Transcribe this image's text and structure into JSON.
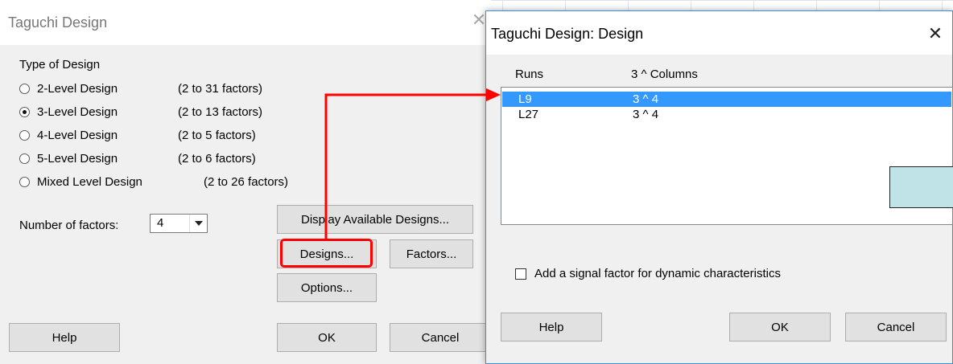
{
  "dialog1": {
    "title": "Taguchi Design",
    "close_glyph": "✕",
    "type_group_label": "Type of Design",
    "designs": [
      {
        "label": "2-Level Design",
        "range": "(2 to 31 factors)",
        "checked": false
      },
      {
        "label": "3-Level Design",
        "range": "(2 to 13 factors)",
        "checked": true
      },
      {
        "label": "4-Level Design",
        "range": "(2 to 5 factors)",
        "checked": false
      },
      {
        "label": "5-Level Design",
        "range": "(2 to 6 factors)",
        "checked": false
      },
      {
        "label": "Mixed Level Design",
        "range": "(2 to 26 factors)",
        "checked": false
      }
    ],
    "num_factors_label": "Number of factors:",
    "num_factors_value": "4",
    "buttons": {
      "display_available": "Display Available Designs...",
      "designs": "Designs...",
      "factors": "Factors...",
      "options": "Options...",
      "help": "Help",
      "ok": "OK",
      "cancel": "Cancel"
    }
  },
  "dialog2": {
    "title": "Taguchi Design: Design",
    "close_glyph": "✕",
    "col_runs": "Runs",
    "col_columns": "3 ^ Columns",
    "rows": [
      {
        "runs": "L9",
        "columns": "3 ^  4",
        "selected": true
      },
      {
        "runs": "L27",
        "columns": "3 ^  4",
        "selected": false
      }
    ],
    "signal_checkbox_label": "Add a signal factor for dynamic characteristics",
    "signal_checked": false,
    "buttons": {
      "help": "Help",
      "ok": "OK",
      "cancel": "Cancel"
    }
  },
  "colors": {
    "annotation_red": "#ff0000",
    "selection_blue": "#3399ff",
    "cyan_box": "#bfe3e6"
  }
}
